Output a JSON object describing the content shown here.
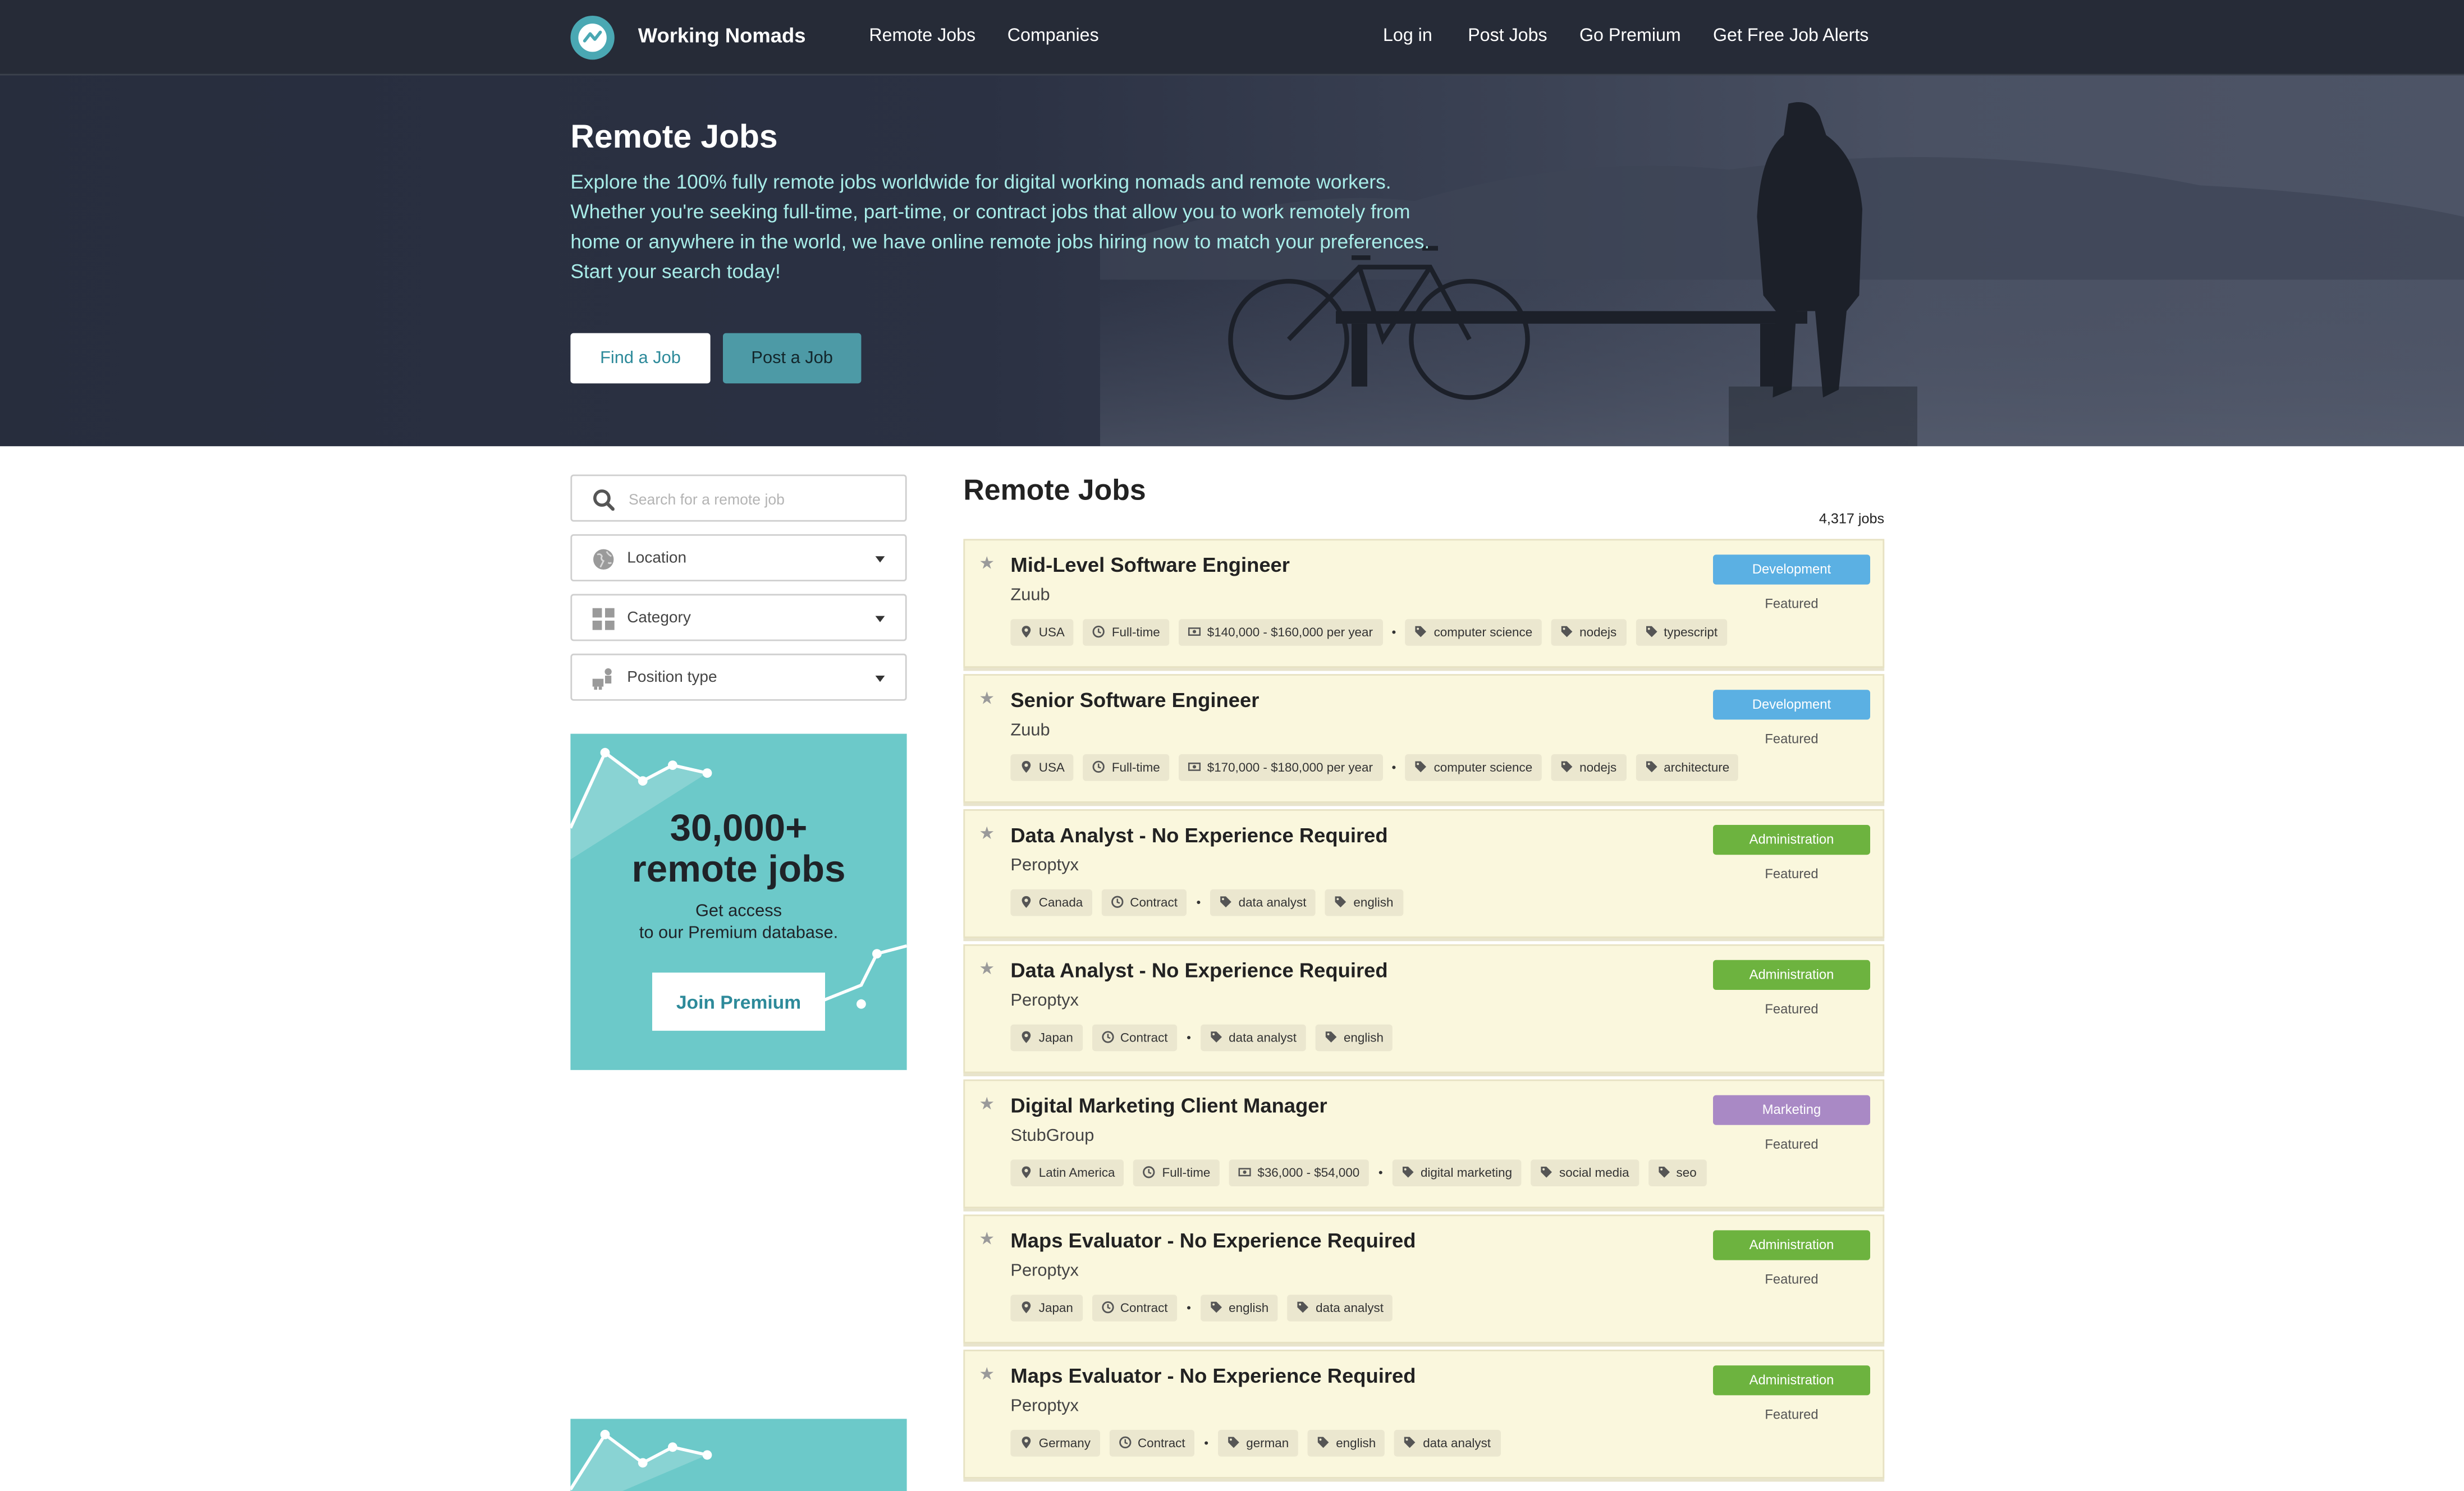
{
  "nav": {
    "brand": "Working Nomads",
    "left_links": [
      "Remote Jobs",
      "Companies"
    ],
    "right_links": [
      "Log in",
      "Post Jobs",
      "Go Premium",
      "Get Free Job Alerts"
    ]
  },
  "hero": {
    "title": "Remote Jobs",
    "description": "Explore the 100% fully remote jobs worldwide for digital working nomads and remote workers. Whether you're seeking full-time, part-time, or contract jobs that allow you to work remotely from home or anywhere in the world, we have online remote jobs hiring now to match your preferences. Start your search today!",
    "find_button": "Find a Job",
    "post_button": "Post a Job"
  },
  "sidebar": {
    "search_placeholder": "Search for a remote job",
    "location_label": "Location",
    "category_label": "Category",
    "position_label": "Position type"
  },
  "promo": {
    "line1": "30,000+",
    "line2": "remote jobs",
    "line3": "Get access",
    "line4": "to our Premium database.",
    "button": "Join Premium"
  },
  "main": {
    "title": "Remote Jobs",
    "count": "4,317 jobs"
  },
  "colors": {
    "Development": "#5bb0e3",
    "Administration": "#6db33f",
    "Marketing": "#a989c5"
  },
  "jobs": [
    {
      "title": "Mid-Level Software Engineer",
      "company": "Zuub",
      "category": "Development",
      "featured": "Featured",
      "meta": [
        {
          "icon": "pin",
          "text": "USA"
        },
        {
          "icon": "clock",
          "text": "Full-time"
        },
        {
          "icon": "money",
          "text": "$140,000 - $160,000 per year"
        }
      ],
      "tags": [
        "computer science",
        "nodejs",
        "typescript"
      ]
    },
    {
      "title": "Senior Software Engineer",
      "company": "Zuub",
      "category": "Development",
      "featured": "Featured",
      "meta": [
        {
          "icon": "pin",
          "text": "USA"
        },
        {
          "icon": "clock",
          "text": "Full-time"
        },
        {
          "icon": "money",
          "text": "$170,000 - $180,000 per year"
        }
      ],
      "tags": [
        "computer science",
        "nodejs",
        "architecture"
      ]
    },
    {
      "title": "Data Analyst - No Experience Required",
      "company": "Peroptyx",
      "category": "Administration",
      "featured": "Featured",
      "meta": [
        {
          "icon": "pin",
          "text": "Canada"
        },
        {
          "icon": "clock",
          "text": "Contract"
        }
      ],
      "tags": [
        "data analyst",
        "english"
      ]
    },
    {
      "title": "Data Analyst - No Experience Required",
      "company": "Peroptyx",
      "category": "Administration",
      "featured": "Featured",
      "meta": [
        {
          "icon": "pin",
          "text": "Japan"
        },
        {
          "icon": "clock",
          "text": "Contract"
        }
      ],
      "tags": [
        "data analyst",
        "english"
      ]
    },
    {
      "title": "Digital Marketing Client Manager",
      "company": "StubGroup",
      "category": "Marketing",
      "featured": "Featured",
      "meta": [
        {
          "icon": "pin",
          "text": "Latin America"
        },
        {
          "icon": "clock",
          "text": "Full-time"
        },
        {
          "icon": "money",
          "text": "$36,000 - $54,000"
        }
      ],
      "tags": [
        "digital marketing",
        "social media",
        "seo"
      ]
    },
    {
      "title": "Maps Evaluator - No Experience Required",
      "company": "Peroptyx",
      "category": "Administration",
      "featured": "Featured",
      "meta": [
        {
          "icon": "pin",
          "text": "Japan"
        },
        {
          "icon": "clock",
          "text": "Contract"
        }
      ],
      "tags": [
        "english",
        "data analyst"
      ]
    },
    {
      "title": "Maps Evaluator - No Experience Required",
      "company": "Peroptyx",
      "category": "Administration",
      "featured": "Featured",
      "meta": [
        {
          "icon": "pin",
          "text": "Germany"
        },
        {
          "icon": "clock",
          "text": "Contract"
        }
      ],
      "tags": [
        "german",
        "english",
        "data analyst"
      ]
    }
  ]
}
